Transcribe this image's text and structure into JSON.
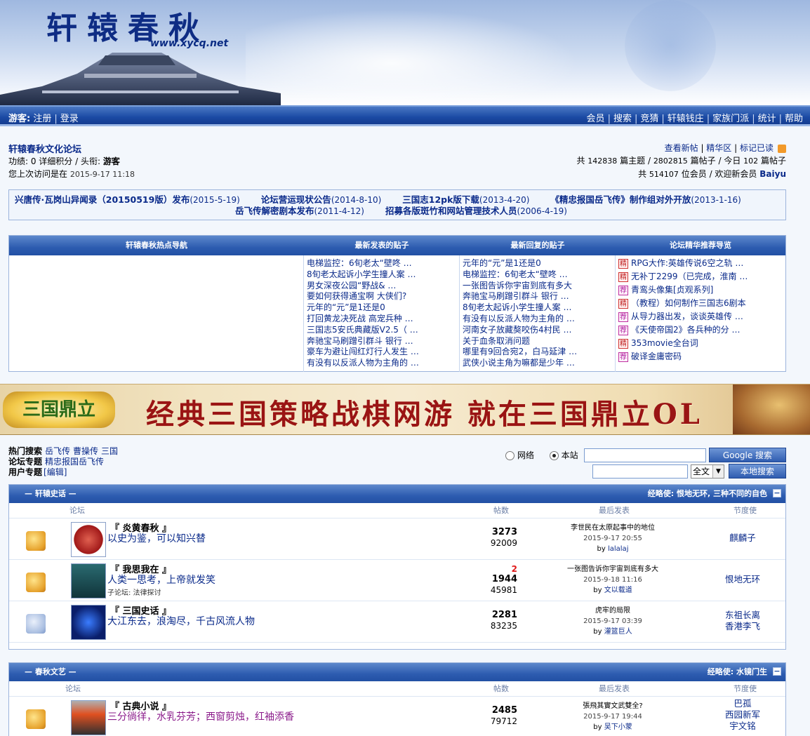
{
  "header": {
    "logo_text": "轩辕春秋",
    "site_url": "www.xycq.net"
  },
  "navbar": {
    "guest_label": "游客:",
    "register": "注册",
    "login": "登录",
    "links": [
      "会员",
      "搜索",
      "竞猜",
      "轩辕钱庄",
      "家族门派",
      "统计",
      "帮助"
    ]
  },
  "forum_info": {
    "title": "轩辕春秋文化论坛",
    "user_line_prefix": "功绩: 0 详细积分 / 头衔:",
    "user_title": "游客",
    "last_visit_label": "您上次访问是在",
    "last_visit_time": "2015-9-17 11:18",
    "links": [
      "查看新帖",
      "精华区",
      "标记已读"
    ],
    "stats_topics_label": "共",
    "stats_topics": "142838",
    "stats_topics_unit": "篇主题 /",
    "stats_posts": "2802815",
    "stats_posts_unit": "篇帖子 / 今日",
    "stats_today": "102",
    "stats_today_unit": "篇帖子",
    "stats_members_label": "共",
    "stats_members": "514107",
    "stats_members_unit": "位会员 / 欢迎新会员",
    "new_member": "Baiyu"
  },
  "announcements": [
    {
      "title": "兴唐传·瓦岗山异闻录（20150519版）发布",
      "date": "(2015-5-19)"
    },
    {
      "title": "论坛营运现状公告",
      "date": "(2014-8-10)"
    },
    {
      "title": "三国志12pk版下载",
      "date": "(2013-4-20)"
    },
    {
      "title": "《精忠报国岳飞传》制作组对外开放",
      "date": "(2013-1-16)"
    },
    {
      "title": "岳飞传解密剧本发布",
      "date": "(2011-4-12)"
    },
    {
      "title": "招募各版斑竹和网站管理技术人员",
      "date": "(2006-4-19)"
    }
  ],
  "nav_table": {
    "headers": [
      "轩辕春秋热点导航",
      "最新发表的贴子",
      "最新回复的贴子",
      "论坛精华推荐导览"
    ],
    "latest_posts": [
      "电梯监控：6旬老太“壁咚 …",
      "8旬老太起诉小学生撞人案 …",
      "男女深夜公园“野战& …",
      "要如何获得通宝啊 大侠们?",
      "元年的“元”是1还是0",
      "打回黄龙决死战 高宠兵种 …",
      "三国志5安氏典藏版V2.5（ …",
      "奔驰宝马刷蹭引群斗 银行 …",
      "豪车为避让闯红灯行人发生 …",
      "有没有以反派人物为主角的 …"
    ],
    "latest_replies": [
      "元年的“元”是1还是0",
      "电梯监控：6旬老太“壁咚 …",
      "一张图告诉你宇宙到底有多大",
      "奔驰宝马刷蹭引群斗 银行 …",
      "8旬老太起诉小学生撞人案 …",
      "有没有以反派人物为主角的 …",
      "河南女子放藏獒咬伤4村民 …",
      "关于血条取消问题",
      "哪里有9回合宛2，白马延津 …",
      "武侠小说主角为嘛都是少年 …"
    ],
    "featured": [
      {
        "tag": "精",
        "color": "red",
        "text": "RPG大作:英雄传说6空之轨 …"
      },
      {
        "tag": "精",
        "color": "red",
        "text": "无补丁2299（已完成，淮南 …"
      },
      {
        "tag": "荐",
        "color": "pink",
        "text": "青鸾头像集[贞观系列]"
      },
      {
        "tag": "精",
        "color": "red",
        "text": "（教程）如何制作三国志6剧本"
      },
      {
        "tag": "荐",
        "color": "pink",
        "text": "从导力器出发，谈谈英雄传 …"
      },
      {
        "tag": "荐",
        "color": "pink",
        "text": "《天使帝国2》各兵种的分 …"
      },
      {
        "tag": "精",
        "color": "red",
        "text": "353movie全台词"
      },
      {
        "tag": "荐",
        "color": "pink",
        "text": "破译金庸密码"
      }
    ]
  },
  "banner": {
    "logo": "三国鼎立",
    "slogan": "经典三国策略战棋网游 就在三国鼎立OL"
  },
  "search": {
    "hot_label": "热门搜索",
    "hot_terms": [
      "岳飞传",
      "曹操传",
      "三国"
    ],
    "special_label": "论坛专题",
    "special_link": "精忠报国岳飞传",
    "user_label": "用户专题",
    "user_edit": "[编辑]",
    "radio_web": "网络",
    "radio_site": "本站",
    "google_btn": "Google 搜索",
    "scope_value": "全文",
    "local_btn": "本地搜索"
  },
  "sections": [
    {
      "title": "— 轩辕史话 —",
      "moderator": "经略使: 恨地无环, 三种不同的自色",
      "columns": [
        "论坛",
        "帖数",
        "最后发表",
        "节度使"
      ],
      "forums": [
        {
          "name": "『 炎黄春秋 』",
          "desc": "以史为鉴，可以知兴替",
          "sub": "",
          "today": "",
          "topics": "3273",
          "posts": "92009",
          "last_title": "李世民在太原起事中的地位",
          "last_time": "2015-9-17 20:55",
          "last_by": "by",
          "last_user": "lalalaj",
          "mods": [
            "麒麟子"
          ],
          "status": "new"
        },
        {
          "name": "『 我思我在 』",
          "desc": "人类一思考，上帝就发笑",
          "sub": "子论坛: 法律探讨",
          "today": "2",
          "topics": "1944",
          "posts": "45981",
          "last_title": "一张图告诉你宇宙到底有多大",
          "last_time": "2015-9-18 11:16",
          "last_by": "by",
          "last_user": "文以载道",
          "mods": [
            "恨地无环"
          ],
          "status": "new"
        },
        {
          "name": "『 三国史话 』",
          "desc": "大江东去，浪淘尽，千古风流人物",
          "sub": "",
          "today": "",
          "topics": "2281",
          "posts": "83235",
          "last_title": "虎牢的局限",
          "last_time": "2015-9-17 03:39",
          "last_by": "by",
          "last_user": "灌篮巨人",
          "mods": [
            "东祖长离",
            "香港李飞"
          ],
          "status": "old"
        }
      ]
    },
    {
      "title": "— 春秋文艺 —",
      "moderator": "经略使: 水镜门生",
      "columns": [
        "论坛",
        "帖数",
        "最后发表",
        "节度使"
      ],
      "forums": [
        {
          "name": "『 古典小说 』",
          "desc": "三分徜徉，水乳芬芳；西窗剪烛，红袖添香",
          "sub": "",
          "today": "",
          "topics": "2485",
          "posts": "79712",
          "last_title": "張飛其實文武雙全?",
          "last_time": "2015-9-17 19:44",
          "last_by": "by",
          "last_user": "吴下小蒙",
          "mods": [
            "巴孤",
            "西园新军",
            "宇文铭"
          ],
          "status": "new"
        }
      ]
    }
  ]
}
